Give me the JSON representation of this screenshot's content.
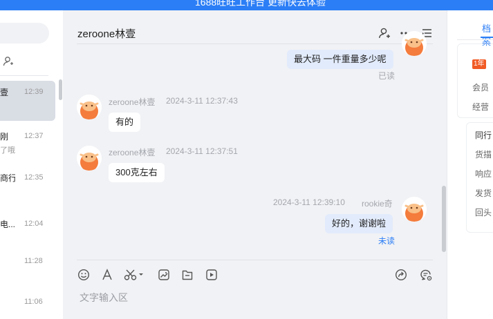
{
  "top_banner": "1688旺旺工作台 更新快去体验",
  "left_panel": {
    "conversations": [
      {
        "name": "壹",
        "sub": "",
        "time": "12:39",
        "active": true
      },
      {
        "name": "刚",
        "sub": "了哦",
        "time": "12:37",
        "active": false
      },
      {
        "name": "商行",
        "sub": "",
        "time": "12:35",
        "active": false
      },
      {
        "name": "电...",
        "sub": "",
        "time": "12:04",
        "active": false
      },
      {
        "name": "",
        "sub": "",
        "time": "11:28",
        "active": false
      },
      {
        "name": "",
        "sub": "",
        "time": "11:06",
        "active": false
      }
    ]
  },
  "chat": {
    "title": "zeroone林壹",
    "messages": [
      {
        "dir": "out",
        "text": "最大码 一件重量多少呢",
        "status": "已读"
      },
      {
        "dir": "in",
        "sender": "zeroone林壹",
        "time": "2024-3-11 12:37:43",
        "text": "有的"
      },
      {
        "dir": "in",
        "sender": "zeroone林壹",
        "time": "2024-3-11 12:37:51",
        "text": "300克左右"
      },
      {
        "dir": "out",
        "sender": "rookie奇",
        "time": "2024-3-11 12:39:10",
        "text": "好的，谢谢啦",
        "status": "未读"
      }
    ],
    "input_placeholder": "文字输入区"
  },
  "right_panel": {
    "tab": "档案",
    "badge": "1年",
    "rows_top": [
      "会员",
      "经营"
    ],
    "card_title": "同行",
    "rows": [
      "货描",
      "响应",
      "发货",
      "回头"
    ]
  },
  "colors": {
    "accent": "#2b7ef6",
    "read": "#a3a6ad",
    "unread": "#2b7ef6",
    "avatar": "#f47c3c"
  },
  "icons": [
    "person-add-icon",
    "more-dots-icon",
    "list-icon",
    "emoji-icon",
    "font-icon",
    "scissors-icon",
    "image-icon",
    "file-icon",
    "video-icon",
    "share-icon",
    "chat-settings-icon"
  ]
}
